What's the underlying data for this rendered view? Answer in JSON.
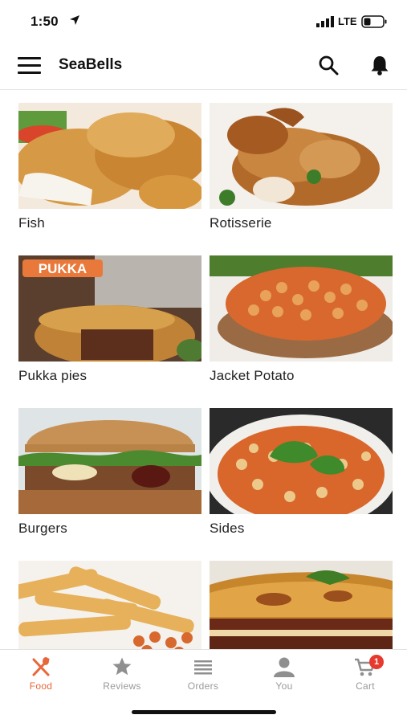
{
  "status_bar": {
    "time": "1:50",
    "network": "LTE"
  },
  "header": {
    "title": "SeaBells"
  },
  "categories": [
    {
      "label": "Fish"
    },
    {
      "label": "Rotisserie"
    },
    {
      "label": "Pukka pies",
      "badge": "PUKKA"
    },
    {
      "label": "Jacket Potato"
    },
    {
      "label": "Burgers"
    },
    {
      "label": "Sides"
    },
    {
      "label": ""
    },
    {
      "label": ""
    }
  ],
  "tabs": [
    {
      "label": "Food",
      "icon": "fork-knife-icon",
      "active": true
    },
    {
      "label": "Reviews",
      "icon": "star-icon"
    },
    {
      "label": "Orders",
      "icon": "list-icon"
    },
    {
      "label": "You",
      "icon": "person-icon"
    },
    {
      "label": "Cart",
      "icon": "cart-icon",
      "badge": "1"
    }
  ],
  "colors": {
    "accent": "#e8673a",
    "inactive": "#9a9a9a",
    "badge": "#e63a2f"
  }
}
